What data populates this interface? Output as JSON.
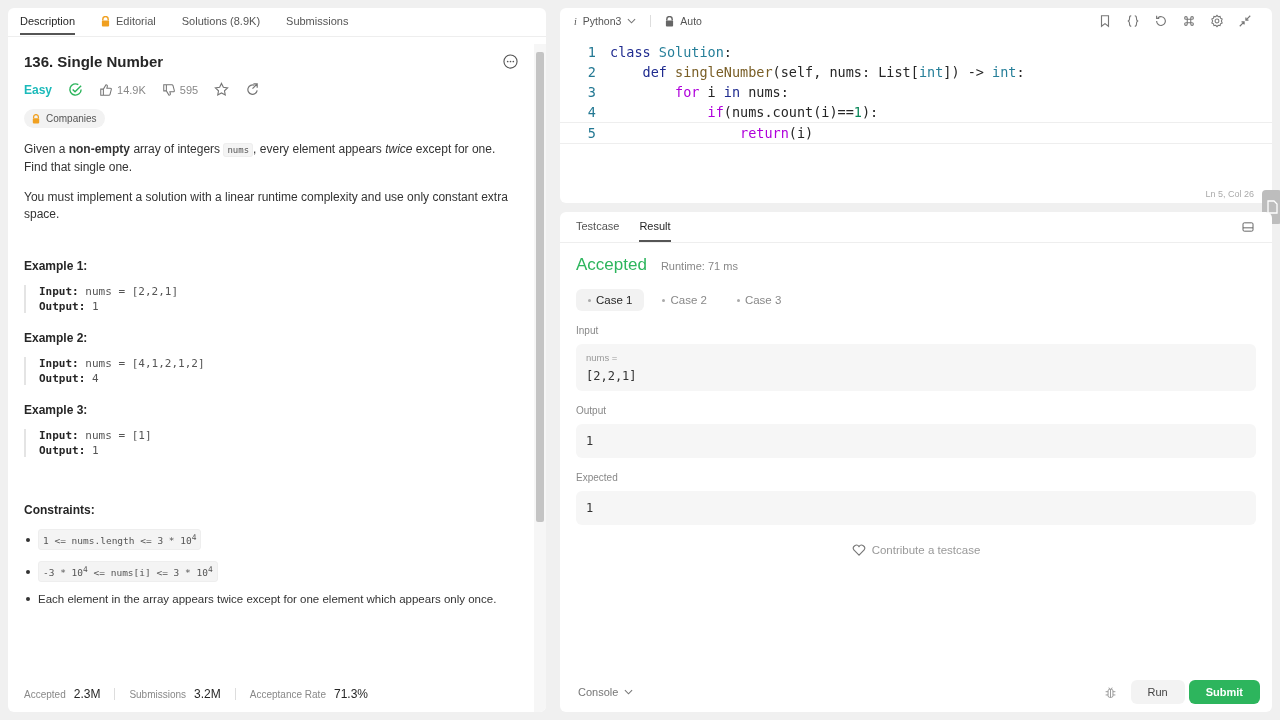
{
  "left_tabs": [
    {
      "label": "Description",
      "selected": true,
      "locked": false
    },
    {
      "label": "Editorial",
      "selected": false,
      "locked": true
    },
    {
      "label": "Solutions (8.9K)",
      "selected": false,
      "locked": false
    },
    {
      "label": "Submissions",
      "selected": false,
      "locked": false
    }
  ],
  "problem": {
    "title": "136. Single Number",
    "difficulty": "Easy",
    "solved": true,
    "likes": "14.9K",
    "dislikes": "595",
    "companies": "Companies",
    "paragraphs": [
      [
        {
          "kind": "text",
          "text": "Given a **non-empty** array of integers "
        },
        {
          "kind": "code",
          "text": "nums"
        },
        {
          "kind": "text",
          "text": ", every element appears *twice* except for one. Find that single one."
        }
      ],
      [
        {
          "kind": "text",
          "text": "You must implement a solution with a linear runtime complexity and use only constant extra space."
        }
      ]
    ],
    "examples": [
      {
        "title": "Example 1:",
        "input_label": "Input:",
        "input": "nums = [2,2,1]",
        "output_label": "Output:",
        "output": "1"
      },
      {
        "title": "Example 2:",
        "input_label": "Input:",
        "input": "nums = [4,1,2,1,2]",
        "output_label": "Output:",
        "output": "4"
      },
      {
        "title": "Example 3:",
        "input_label": "Input:",
        "input": "nums = [1]",
        "output_label": "Output:",
        "output": "1"
      }
    ],
    "constraints_title": "Constraints:",
    "constraints": [
      {
        "kind": "code",
        "text": "1 <= nums.length <= 3 * 10$^{4}$"
      },
      {
        "kind": "code",
        "text": "-3 * 10$^{4}$ <= nums[i] <= 3 * 10$^{4}$"
      },
      {
        "kind": "text",
        "text": "Each element in the array appears twice except for one element which appears only once."
      }
    ],
    "stats": [
      {
        "label": "Accepted",
        "value": "2.3M"
      },
      {
        "label": "Submissions",
        "value": "3.2M"
      },
      {
        "label": "Acceptance Rate",
        "value": "71.3%"
      }
    ]
  },
  "editor": {
    "language_icon": "i",
    "language": "Python3",
    "mode": "Auto",
    "position": "Ln 5, Col 26",
    "lines": [
      {
        "number": "1",
        "tokens": [
          {
            "kind": "keyword",
            "text": "class"
          },
          {
            "kind": "type",
            "text": " Solution"
          },
          {
            "kind": "plain",
            "text": ":"
          }
        ]
      },
      {
        "number": "2",
        "tokens": [
          {
            "kind": "keyword",
            "text": "    def"
          },
          {
            "kind": "function",
            "text": " singleNumber"
          },
          {
            "kind": "plain",
            "text": "(self, nums: List["
          },
          {
            "kind": "type",
            "text": "int"
          },
          {
            "kind": "plain",
            "text": "]) -> "
          },
          {
            "kind": "type",
            "text": "int"
          },
          {
            "kind": "plain",
            "text": ":"
          }
        ]
      },
      {
        "number": "3",
        "tokens": [
          {
            "kind": "control",
            "text": "        for"
          },
          {
            "kind": "plain",
            "text": " i "
          },
          {
            "kind": "keyword",
            "text": "in"
          },
          {
            "kind": "plain",
            "text": " nums:"
          }
        ]
      },
      {
        "number": "4",
        "tokens": [
          {
            "kind": "control",
            "text": "            if"
          },
          {
            "kind": "plain",
            "text": "(nums.count(i)=="
          },
          {
            "kind": "number",
            "text": "1"
          },
          {
            "kind": "plain",
            "text": "):"
          }
        ]
      },
      {
        "number": "5",
        "tokens": [
          {
            "kind": "control",
            "text": "                return"
          },
          {
            "kind": "plain",
            "text": "(i)"
          }
        ]
      }
    ]
  },
  "result_tabs": [
    {
      "label": "Testcase",
      "selected": false
    },
    {
      "label": "Result",
      "selected": true
    }
  ],
  "result": {
    "status": "Accepted",
    "runtime": "Runtime: 71 ms",
    "cases": [
      {
        "label": "Case 1",
        "selected": true
      },
      {
        "label": "Case 2",
        "selected": false
      },
      {
        "label": "Case 3",
        "selected": false
      }
    ],
    "input_label": "Input",
    "input_name": "nums =",
    "input_value": "[2,2,1]",
    "output_label": "Output",
    "output_value": "1",
    "expected_label": "Expected",
    "expected_value": "1",
    "contribute": "Contribute a testcase"
  },
  "footer": {
    "console": "Console",
    "run": "Run",
    "submit": "Submit"
  }
}
